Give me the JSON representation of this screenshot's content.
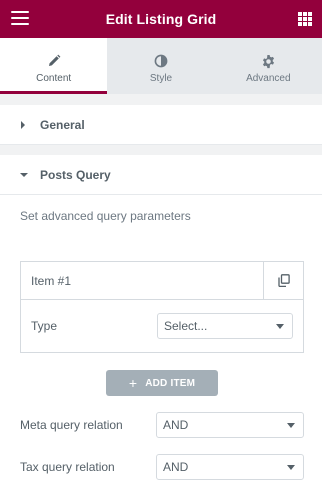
{
  "header": {
    "title": "Edit Listing Grid",
    "menu_icon": "hamburger-icon",
    "apps_icon": "grid-icon",
    "bg_color": "#93003c"
  },
  "tabs": [
    {
      "label": "Content",
      "icon": "pencil-icon",
      "active": true
    },
    {
      "label": "Style",
      "icon": "half-circle-icon",
      "active": false
    },
    {
      "label": "Advanced",
      "icon": "gear-icon",
      "active": false
    }
  ],
  "sections": {
    "general": {
      "title": "General",
      "expanded": false
    },
    "posts_query": {
      "title": "Posts Query",
      "expanded": true,
      "description": "Set advanced query parameters",
      "repeater": {
        "item_title": "Item #1",
        "type_label": "Type",
        "type_value": "Select..."
      },
      "add_item_label": "ADD ITEM",
      "meta_relation": {
        "label": "Meta query relation",
        "value": "AND"
      },
      "tax_relation": {
        "label": "Tax query relation",
        "value": "AND"
      }
    }
  }
}
